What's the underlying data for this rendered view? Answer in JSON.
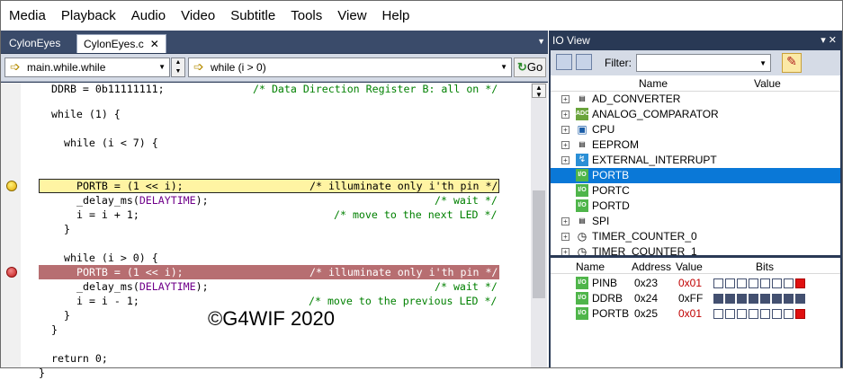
{
  "menu": [
    "Media",
    "Playback",
    "Audio",
    "Video",
    "Subtitle",
    "Tools",
    "View",
    "Help"
  ],
  "editor": {
    "tabs": [
      {
        "label": "CylonEyes",
        "active": false
      },
      {
        "label": "CylonEyes.c",
        "active": true,
        "close": "✕"
      }
    ],
    "tab_menu_icon": "chevron-down-icon",
    "scope_combo": "main.while.while",
    "function_combo": "while (i > 0)",
    "go_label": "Go",
    "code_lines": [
      {
        "text": "DDRB = 0b11111111;",
        "comment": "/* Data Direction Register B: all on */"
      },
      {
        "text": "while (1) {",
        "comment": ""
      },
      {
        "text": "while (i < 7) {",
        "comment": ""
      },
      {
        "text": "PORTB = (1 << i);",
        "comment": "/* illuminate only i'th pin */"
      },
      {
        "text": "_delay_ms(",
        "macro": "DELAYTIME",
        "tail": ");",
        "comment": "/* wait */"
      },
      {
        "text": "i = i + 1;",
        "comment": "/* move to the next LED */"
      },
      {
        "text": "}",
        "comment": ""
      },
      {
        "text": "while (i > 0) {",
        "comment": ""
      },
      {
        "text": "PORTB = (1 << i);",
        "comment": "/* illuminate only i'th pin */"
      },
      {
        "text": "_delay_ms(",
        "macro": "DELAYTIME",
        "tail": ");",
        "comment": "/* wait */"
      },
      {
        "text": "i = i - 1;",
        "comment": "/* move to the previous LED */"
      },
      {
        "text": "}",
        "comment": ""
      },
      {
        "text": "}",
        "comment": ""
      },
      {
        "text": "return 0;",
        "comment": ""
      },
      {
        "text": "}",
        "comment": ""
      }
    ],
    "watermark": "©G4WIF 2020"
  },
  "io_view": {
    "title": "IO View",
    "filter_label": "Filter:",
    "filter_value": "",
    "tree_header": {
      "name": "Name",
      "value": "Value"
    },
    "tree_items": [
      {
        "label": "AD_CONVERTER",
        "icon": "doc-icon",
        "expandable": true,
        "selected": false
      },
      {
        "label": "ANALOG_COMPARATOR",
        "icon": "adc-dac-icon",
        "expandable": true,
        "selected": false
      },
      {
        "label": "CPU",
        "icon": "cpu-icon",
        "expandable": true,
        "selected": false
      },
      {
        "label": "EEPROM",
        "icon": "doc-icon",
        "expandable": true,
        "selected": false
      },
      {
        "label": "EXTERNAL_INTERRUPT",
        "icon": "interrupt-icon",
        "expandable": true,
        "selected": false
      },
      {
        "label": "PORTB",
        "icon": "io-icon",
        "expandable": false,
        "selected": true
      },
      {
        "label": "PORTC",
        "icon": "io-icon",
        "expandable": false,
        "selected": false
      },
      {
        "label": "PORTD",
        "icon": "io-icon",
        "expandable": false,
        "selected": false
      },
      {
        "label": "SPI",
        "icon": "doc-icon",
        "expandable": true,
        "selected": false
      },
      {
        "label": "TIMER_COUNTER_0",
        "icon": "clock-icon",
        "expandable": true,
        "selected": false
      },
      {
        "label": "TIMER_COUNTER_1",
        "icon": "clock-icon",
        "expandable": true,
        "selected": false
      }
    ],
    "reg_header": {
      "name": "Name",
      "address": "Address",
      "value": "Value",
      "bits": "Bits"
    },
    "registers": [
      {
        "name": "PINB",
        "address": "0x23",
        "value": "0x01",
        "bits": [
          0,
          0,
          0,
          0,
          0,
          0,
          0,
          1
        ]
      },
      {
        "name": "DDRB",
        "address": "0x24",
        "value": "0xFF",
        "bits": [
          1,
          1,
          1,
          1,
          1,
          1,
          1,
          1
        ]
      },
      {
        "name": "PORTB",
        "address": "0x25",
        "value": "0x01",
        "bits": [
          0,
          0,
          0,
          0,
          0,
          0,
          0,
          1
        ]
      }
    ],
    "io_badge": "I/O",
    "adc_badge": "ADC DAC"
  },
  "colors": {
    "frame_bg": "#293955",
    "selection": "#0a78d7",
    "current_line": "#fff4a3",
    "breakpoint_line": "#b76e71",
    "comment": "#008000",
    "macro": "#6f008a",
    "changed_value": "#c00000"
  }
}
